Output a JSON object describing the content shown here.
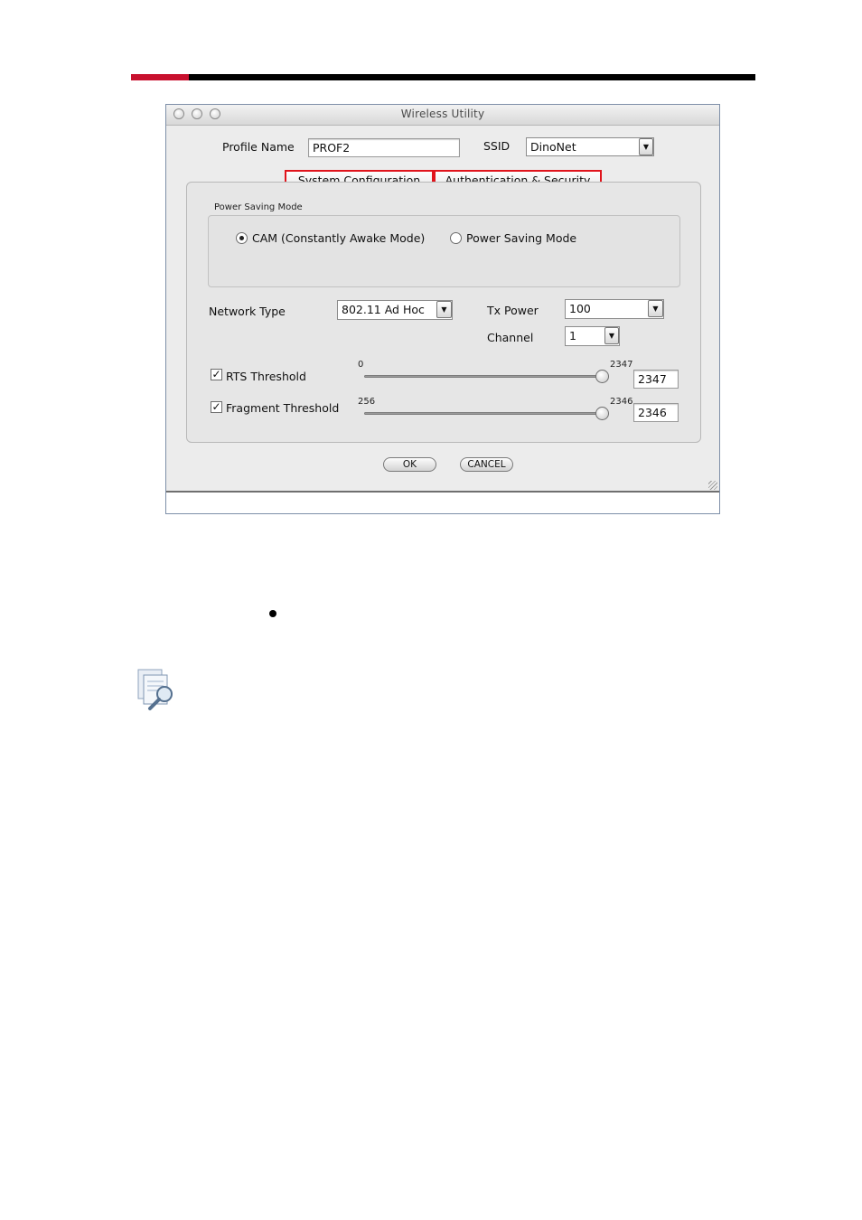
{
  "window": {
    "title": "Wireless Utility"
  },
  "profile": {
    "name_label": "Profile Name",
    "name_value": "PROF2",
    "ssid_label": "SSID",
    "ssid_value": "DinoNet"
  },
  "tabs": [
    {
      "label": "System Configuration"
    },
    {
      "label": "Authentication & Security"
    }
  ],
  "power_saving": {
    "group_label": "Power Saving Mode",
    "options": [
      {
        "label": "CAM (Constantly Awake Mode)",
        "selected": true
      },
      {
        "label": "Power Saving Mode",
        "selected": false
      }
    ]
  },
  "network": {
    "type_label": "Network Type",
    "type_value": "802.11 Ad Hoc",
    "tx_label": "Tx Power",
    "tx_value": "100",
    "channel_label": "Channel",
    "channel_value": "1"
  },
  "rts": {
    "label": "RTS Threshold",
    "checked": true,
    "min": "0",
    "max": "2347",
    "value": "2347",
    "level": 1.0
  },
  "fragment": {
    "label": "Fragment Threshold",
    "checked": true,
    "min": "256",
    "max": "2346",
    "value": "2346",
    "level": 1.0
  },
  "buttons": {
    "ok": "OK",
    "cancel": "CANCEL"
  },
  "icons": {
    "check": "✓",
    "dropdown": "▼"
  },
  "colors": {
    "accent_red": "#c8102e",
    "highlight_red": "#e0141c"
  }
}
